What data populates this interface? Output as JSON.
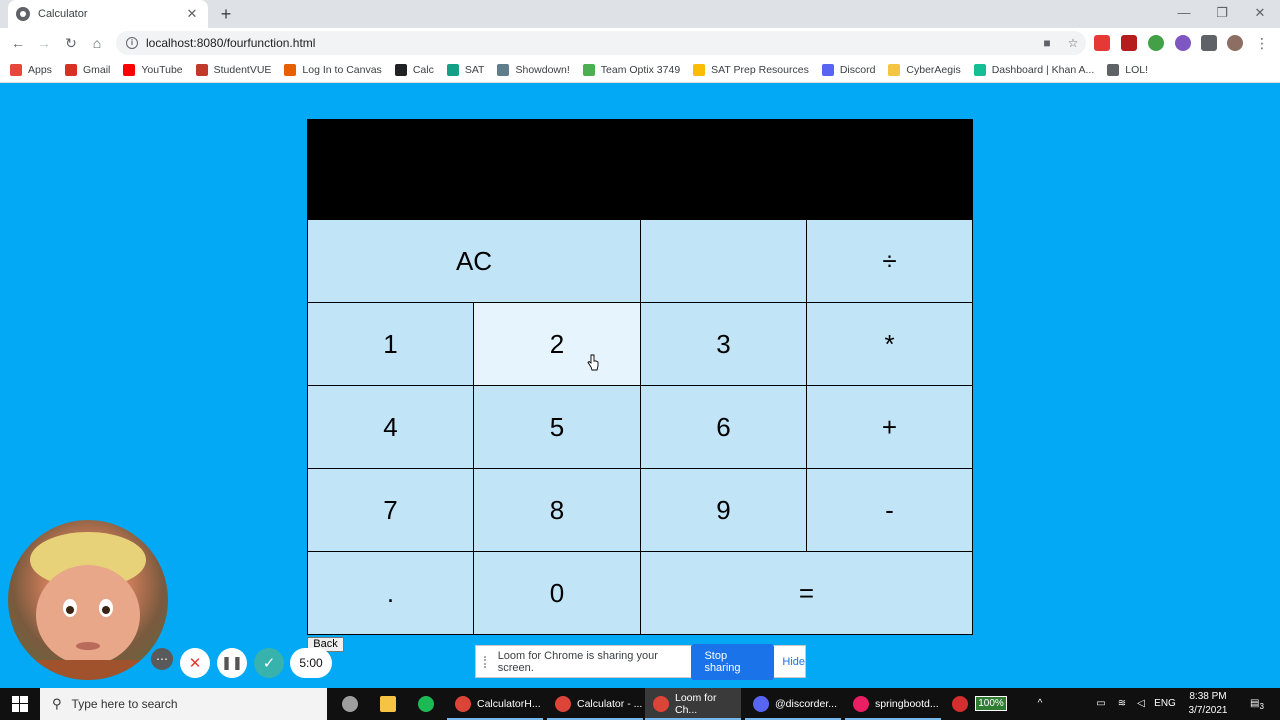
{
  "browser": {
    "tab_title": "Calculator",
    "tab_close": "✕",
    "new_tab": "+",
    "minimize": "—",
    "maximize": "❐",
    "close": "✕",
    "url": "localhost:8080/fourfunction.html",
    "back": "←",
    "forward": "→",
    "reload": "↻",
    "home": "⌂",
    "bookmarks": [
      {
        "label": "Apps",
        "color": "#e8453c"
      },
      {
        "label": "Gmail",
        "color": "#d93025"
      },
      {
        "label": "YouTube",
        "color": "#ff0000"
      },
      {
        "label": "StudentVUE",
        "color": "#c0392b"
      },
      {
        "label": "Log In to Canvas",
        "color": "#e66000"
      },
      {
        "label": "Calc",
        "color": "#202124"
      },
      {
        "label": "SAT",
        "color": "#14a085"
      },
      {
        "label": "Showdown!",
        "color": "#607d8b"
      },
      {
        "label": "Team Optix 3749",
        "color": "#4caf50"
      },
      {
        "label": "SAT Prep Resources",
        "color": "#fbbc04"
      },
      {
        "label": "Discord",
        "color": "#5865f2"
      },
      {
        "label": "CyberAegis",
        "color": "#f4c542"
      },
      {
        "label": "Dashboard | Khan A...",
        "color": "#14bf96"
      },
      {
        "label": "LOL!",
        "color": "#5f6368"
      }
    ]
  },
  "calculator": {
    "display": "",
    "keys": {
      "ac": "AC",
      "blank": "",
      "divide": "÷",
      "one": "1",
      "two": "2",
      "three": "3",
      "multiply": "*",
      "four": "4",
      "five": "5",
      "six": "6",
      "add": "+",
      "seven": "7",
      "eight": "8",
      "nine": "9",
      "subtract": "-",
      "decimal": ".",
      "zero": "0",
      "equals": "="
    },
    "back_label": "Back"
  },
  "loom": {
    "timer": "5:00",
    "share_message": "Loom for Chrome is sharing your screen.",
    "stop_label": "Stop sharing",
    "hide_label": "Hide"
  },
  "taskbar": {
    "search_placeholder": "Type here to search",
    "apps": [
      {
        "label": "CalculatorH...",
        "color": "#db4437"
      },
      {
        "label": "Calculator - ...",
        "color": "#db4437"
      },
      {
        "label": "Loom for Ch...",
        "color": "#db4437"
      },
      {
        "label": "@discorder...",
        "color": "#5865f2"
      },
      {
        "label": "springbootd...",
        "color": "#e91e63"
      }
    ],
    "battery": "100%",
    "language": "ENG",
    "time": "8:38 PM",
    "date": "3/7/2021",
    "notifications": "3"
  }
}
